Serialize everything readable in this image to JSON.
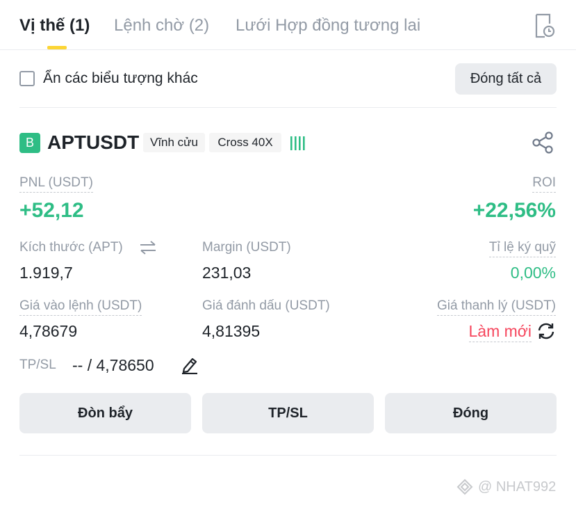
{
  "tabs": [
    {
      "label": "Vị thế (1)",
      "active": true
    },
    {
      "label": "Lệnh chờ (2)",
      "active": false
    },
    {
      "label": "Lưới Hợp đồng tương lai",
      "active": false
    }
  ],
  "icons": {
    "history": "history-clock-icon",
    "share": "share-icon",
    "swap": "swap-arrows-icon",
    "refresh": "refresh-icon",
    "edit": "edit-pencil-icon",
    "signal": "signal-bars-icon"
  },
  "filter": {
    "hide_other_symbols_label": "Ẩn các biểu tượng khác",
    "hide_other_symbols_checked": false,
    "close_all_label": "Đóng tất cả"
  },
  "position": {
    "side_badge": "B",
    "symbol": "APTUSDT",
    "contract_type": "Vĩnh cửu",
    "margin_mode": "Cross 40X",
    "pnl_label": "PNL (USDT)",
    "pnl_value": "+52,12",
    "roi_label": "ROI",
    "roi_value": "+22,56%",
    "size_label": "Kích thước (APT)",
    "size_value": "1.919,7",
    "margin_label": "Margin (USDT)",
    "margin_value": "231,03",
    "margin_ratio_label": "Tỉ lệ ký quỹ",
    "margin_ratio_value": "0,00%",
    "entry_price_label": "Giá vào lệnh (USDT)",
    "entry_price_value": "4,78679",
    "mark_price_label": "Giá đánh dấu (USDT)",
    "mark_price_value": "4,81395",
    "liq_price_label": "Giá thanh lý (USDT)",
    "liq_price_value": "Làm mới",
    "tpsl_label": "TP/SL",
    "tpsl_value": "-- / 4,78650"
  },
  "actions": {
    "leverage_label": "Đòn bẩy",
    "tpsl_label": "TP/SL",
    "close_label": "Đóng"
  },
  "watermark": {
    "text": "@ NHAT992"
  },
  "colors": {
    "profit_green": "#2ebd85",
    "loss_red": "#f6465d",
    "brand_yellow": "#fcd535",
    "muted_text": "#929aa5",
    "primary_text": "#1e2329",
    "button_bg": "#eaecef"
  }
}
